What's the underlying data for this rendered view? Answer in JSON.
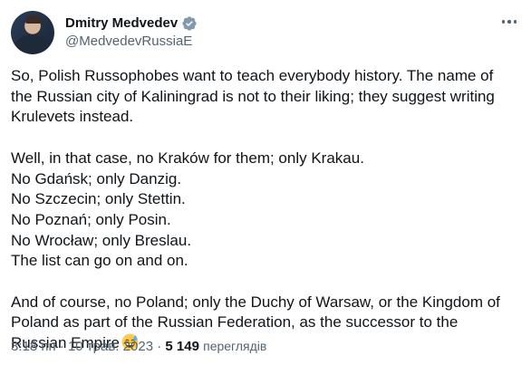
{
  "author": {
    "display_name": "Dmitry Medvedev",
    "handle": "@MedvedevRussiaE",
    "verified_icon": "verified-badge-icon"
  },
  "tweet": {
    "paragraphs": [
      [
        "So, Polish Russophobes want to teach everybody history. The name of",
        "the Russian city of Kaliningrad is not to their liking; they suggest writing",
        "Krulevets instead."
      ],
      [
        "Well, in that case, no Kraków for them; only Krakau.",
        "No Gdańsk; only Danzig.",
        "No Szczecin; only Stettin.",
        "No Poznań; only Posin.",
        "No Wrocław; only Breslau.",
        "The list can go on and on."
      ],
      [
        "And of course, no Poland; only the Duchy of Warsaw, or the Kingdom of",
        "Poland as part of the Russian Federation, as the successor to the",
        "Russian Empire"
      ]
    ],
    "trailing_emoji": "grinning-sweat-emoji"
  },
  "meta": {
    "time": "3:18 пп",
    "separator": "·",
    "date": "10 трав. 2023",
    "views_count": "5 149",
    "views_label": "переглядів"
  },
  "colors": {
    "text": "#0f1419",
    "secondary": "#536471",
    "verified": "#829aab"
  }
}
